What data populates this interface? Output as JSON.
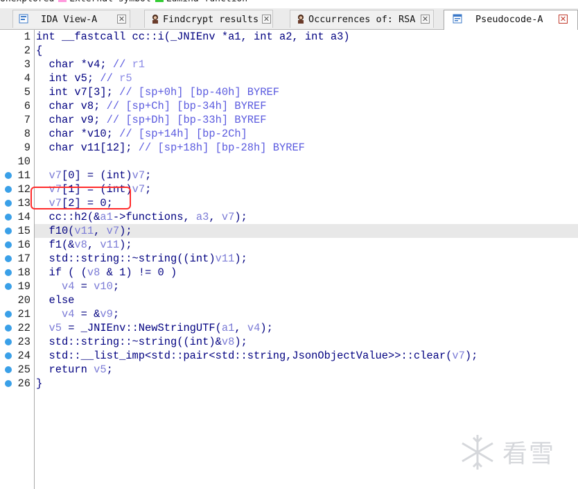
{
  "legend": [
    {
      "label": "Unexplored",
      "color": "#d8c88a"
    },
    {
      "label": "External symbol",
      "color": "#ff99dd"
    },
    {
      "label": "Lumina function",
      "color": "#33cc33"
    }
  ],
  "tabs": [
    {
      "label": "IDA View-A",
      "icon": "disassembly-icon",
      "active": false
    },
    {
      "label": "Findcrypt results",
      "icon": "avatar-icon",
      "active": false
    },
    {
      "label": "Occurrences of: RSA",
      "icon": "avatar-icon",
      "active": false
    },
    {
      "label": "Pseudocode-A",
      "icon": "pseudocode-icon",
      "active": true
    }
  ],
  "close_glyph": "✕",
  "lines": [
    {
      "n": "1",
      "bp": false,
      "code": [
        [
          "t",
          "int __fastcall cc::i(_JNIEnv *a1, int a2, int a3)"
        ]
      ]
    },
    {
      "n": "2",
      "bp": false,
      "code": [
        [
          "t",
          "{"
        ]
      ]
    },
    {
      "n": "3",
      "bp": false,
      "code": [
        [
          "t",
          "  char *v4; "
        ],
        [
          "cm",
          "// "
        ],
        [
          "cm2",
          "r1"
        ]
      ]
    },
    {
      "n": "4",
      "bp": false,
      "code": [
        [
          "t",
          "  int v5; "
        ],
        [
          "cm",
          "// "
        ],
        [
          "cm2",
          "r5"
        ]
      ]
    },
    {
      "n": "5",
      "bp": false,
      "code": [
        [
          "t",
          "  int v7[3]; "
        ],
        [
          "cm",
          "// [sp+0h] [bp-40h] BYREF"
        ]
      ]
    },
    {
      "n": "6",
      "bp": false,
      "code": [
        [
          "t",
          "  char v8; "
        ],
        [
          "cm",
          "// [sp+Ch] [bp-34h] BYREF"
        ]
      ]
    },
    {
      "n": "7",
      "bp": false,
      "code": [
        [
          "t",
          "  char v9; "
        ],
        [
          "cm",
          "// [sp+Dh] [bp-33h] BYREF"
        ]
      ]
    },
    {
      "n": "8",
      "bp": false,
      "code": [
        [
          "t",
          "  char *v10; "
        ],
        [
          "cm",
          "// [sp+14h] [bp-2Ch]"
        ]
      ]
    },
    {
      "n": "9",
      "bp": false,
      "code": [
        [
          "t",
          "  char v11[12]; "
        ],
        [
          "cm",
          "// [sp+18h] [bp-28h] BYREF"
        ]
      ]
    },
    {
      "n": "10",
      "bp": false,
      "code": [
        [
          "t",
          ""
        ]
      ]
    },
    {
      "n": "11",
      "bp": true,
      "code": [
        [
          "t",
          "  "
        ],
        [
          "v",
          "v7"
        ],
        [
          "t",
          "[0] = (int)"
        ],
        [
          "v",
          "v7"
        ],
        [
          "t",
          ";"
        ]
      ]
    },
    {
      "n": "12",
      "bp": true,
      "code": [
        [
          "t",
          "  "
        ],
        [
          "v",
          "v7"
        ],
        [
          "t",
          "[1] = (int)"
        ],
        [
          "v",
          "v7"
        ],
        [
          "t",
          ";"
        ]
      ]
    },
    {
      "n": "13",
      "bp": true,
      "code": [
        [
          "t",
          "  "
        ],
        [
          "v",
          "v7"
        ],
        [
          "t",
          "[2] = 0;"
        ]
      ]
    },
    {
      "n": "14",
      "bp": true,
      "code": [
        [
          "t",
          "  cc::h2(&"
        ],
        [
          "v",
          "a1"
        ],
        [
          "t",
          "->functions, "
        ],
        [
          "v",
          "a3"
        ],
        [
          "t",
          ", "
        ],
        [
          "v",
          "v7"
        ],
        [
          "t",
          ");"
        ]
      ]
    },
    {
      "n": "15",
      "bp": true,
      "code": [
        [
          "t",
          "  f10("
        ],
        [
          "v",
          "v11"
        ],
        [
          "t",
          ", "
        ],
        [
          "v",
          "v7"
        ],
        [
          "t",
          ");"
        ]
      ]
    },
    {
      "n": "16",
      "bp": true,
      "code": [
        [
          "t",
          "  f1(&"
        ],
        [
          "v",
          "v8"
        ],
        [
          "t",
          ", "
        ],
        [
          "v",
          "v11"
        ],
        [
          "t",
          ");"
        ]
      ]
    },
    {
      "n": "17",
      "bp": true,
      "code": [
        [
          "t",
          "  std::string::~string((int)"
        ],
        [
          "v",
          "v11"
        ],
        [
          "t",
          ");"
        ]
      ]
    },
    {
      "n": "18",
      "bp": true,
      "code": [
        [
          "t",
          "  if ( ("
        ],
        [
          "v",
          "v8"
        ],
        [
          "t",
          " & 1) != 0 )"
        ]
      ]
    },
    {
      "n": "19",
      "bp": true,
      "code": [
        [
          "t",
          "    "
        ],
        [
          "v",
          "v4"
        ],
        [
          "t",
          " = "
        ],
        [
          "v",
          "v10"
        ],
        [
          "t",
          ";"
        ]
      ]
    },
    {
      "n": "20",
      "bp": false,
      "code": [
        [
          "t",
          "  else"
        ]
      ]
    },
    {
      "n": "21",
      "bp": true,
      "code": [
        [
          "t",
          "    "
        ],
        [
          "v",
          "v4"
        ],
        [
          "t",
          " = &"
        ],
        [
          "v",
          "v9"
        ],
        [
          "t",
          ";"
        ]
      ]
    },
    {
      "n": "22",
      "bp": true,
      "code": [
        [
          "t",
          "  "
        ],
        [
          "v",
          "v5"
        ],
        [
          "t",
          " = _JNIEnv::NewStringUTF("
        ],
        [
          "v",
          "a1"
        ],
        [
          "t",
          ", "
        ],
        [
          "v",
          "v4"
        ],
        [
          "t",
          ");"
        ]
      ]
    },
    {
      "n": "23",
      "bp": true,
      "code": [
        [
          "t",
          "  std::string::~string((int)&"
        ],
        [
          "v",
          "v8"
        ],
        [
          "t",
          ");"
        ]
      ]
    },
    {
      "n": "24",
      "bp": true,
      "code": [
        [
          "t",
          "  std::__list_imp<std::pair<std::string,JsonObjectValue>>::clear("
        ],
        [
          "v",
          "v7"
        ],
        [
          "t",
          ");"
        ]
      ]
    },
    {
      "n": "25",
      "bp": true,
      "code": [
        [
          "t",
          "  return "
        ],
        [
          "v",
          "v5"
        ],
        [
          "t",
          ";"
        ]
      ]
    },
    {
      "n": "26",
      "bp": true,
      "code": [
        [
          "t",
          "}"
        ]
      ]
    }
  ],
  "highlighted_line": "15",
  "watermark": {
    "text": "看雪",
    "icon": "snowflake-icon"
  }
}
